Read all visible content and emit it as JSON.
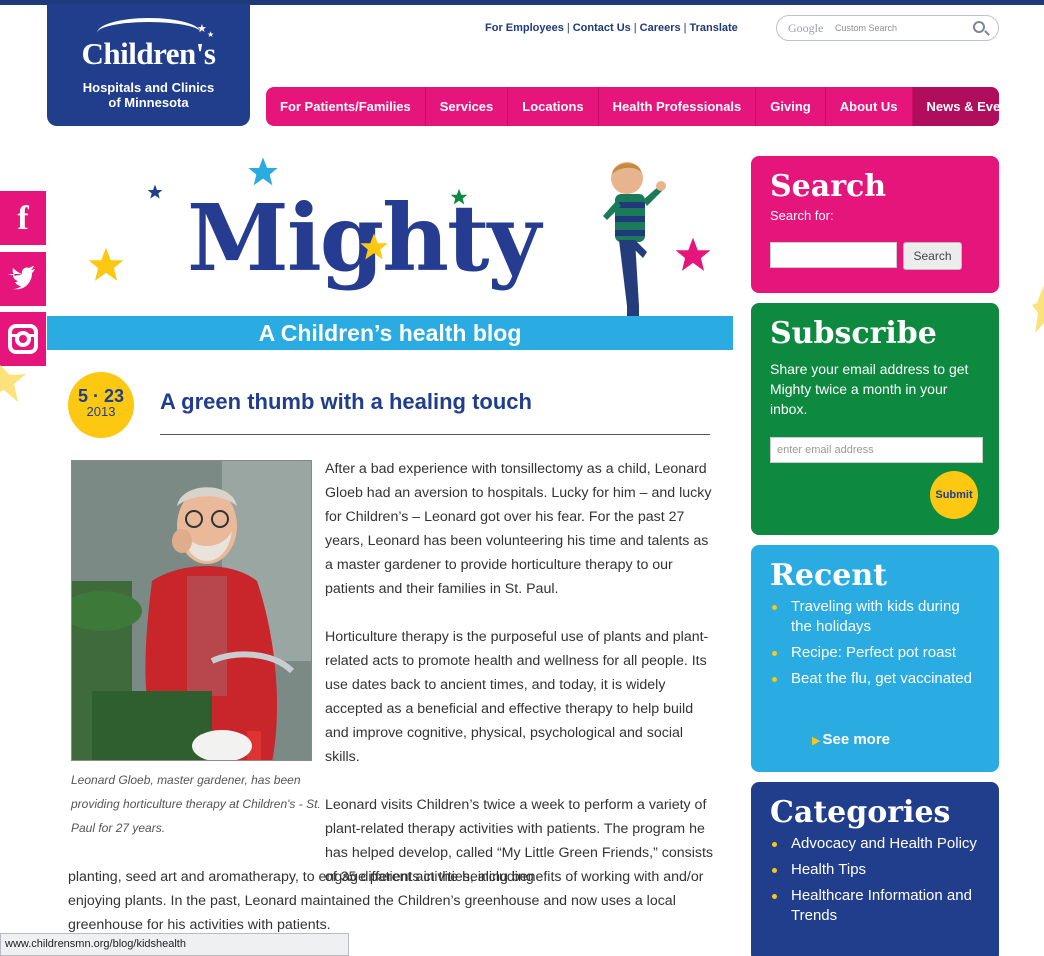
{
  "logo": {
    "name": "Children's",
    "line1": "Hospitals and Clinics",
    "line2": "of Minnesota"
  },
  "utility_links": [
    "For Employees",
    "Contact Us",
    "Careers",
    "Translate"
  ],
  "google_search": {
    "brand": "Google",
    "placeholder": "Custom Search"
  },
  "nav": [
    "For Patients/Families",
    "Services",
    "Locations",
    "Health Professionals",
    "Giving",
    "About Us",
    "News & Events"
  ],
  "social": [
    {
      "name": "facebook",
      "icon": "facebook-icon"
    },
    {
      "name": "twitter",
      "icon": "twitter-icon"
    },
    {
      "name": "instagram",
      "icon": "instagram-icon"
    }
  ],
  "masthead": {
    "title": "Mighty",
    "tagline": "A Children’s health blog"
  },
  "post": {
    "date_md": "5 · 23",
    "date_year": "2013",
    "title": "A green thumb with a healing touch",
    "caption": "Leonard Gloeb, master gardener, has been providing horticulture therapy at Children's - St. Paul for 27 years.",
    "p1": "After a bad experience with tonsillectomy as a child, Leonard Gloeb had an aversion to hospitals. Lucky for him – and lucky for Children’s – Leonard got over his fear. For the past 27 years, Leonard has been volunteering his time and talents as a master gardener to provide horticulture therapy to our patients and their families in St. Paul.",
    "p2": "Horticulture therapy is the purposeful use of plants and plant-related acts to promote health and wellness for all people. Its use dates back to ancient times, and today, it is widely accepted as a beneficial and effective therapy to help build and improve cognitive, physical, psychological and social skills.",
    "p3a": "Leonard visits Children’s  twice a week to perform a variety of plant-related therapy activities with patients. The program he has helped develop, called “My Little Green Friends,” consists of 35 different activities, including",
    "p3b": "planting, seed art and aromatherapy, to engage patients in the healing benefits of working with and/or enjoying plants. In the past, Leonard maintained the Children’s greenhouse and now uses a local greenhouse for his activities with patients."
  },
  "sidebar": {
    "search": {
      "title": "Search",
      "label": "Search for:",
      "button": "Search"
    },
    "subscribe": {
      "title": "Subscribe",
      "text": "Share your email address to get Mighty twice a month in your inbox.",
      "placeholder": "enter email address",
      "button": "Submit"
    },
    "recent": {
      "title": "Recent",
      "items": [
        "Traveling with kids during the holidays",
        "Recipe: Perfect pot roast",
        "Beat the flu, get vaccinated"
      ],
      "see_more": "See more"
    },
    "categories": {
      "title": "Categories",
      "items": [
        "Advocacy and Health Policy",
        "Health Tips",
        "Healthcare Information and Trends"
      ]
    }
  },
  "status_url": "www.childrensmn.org/blog/kidshealth",
  "colors": {
    "navy": "#213e8c",
    "pink": "#e5157b",
    "green": "#0d8a3f",
    "blue": "#2aabe2",
    "yellow": "#fcc812"
  }
}
